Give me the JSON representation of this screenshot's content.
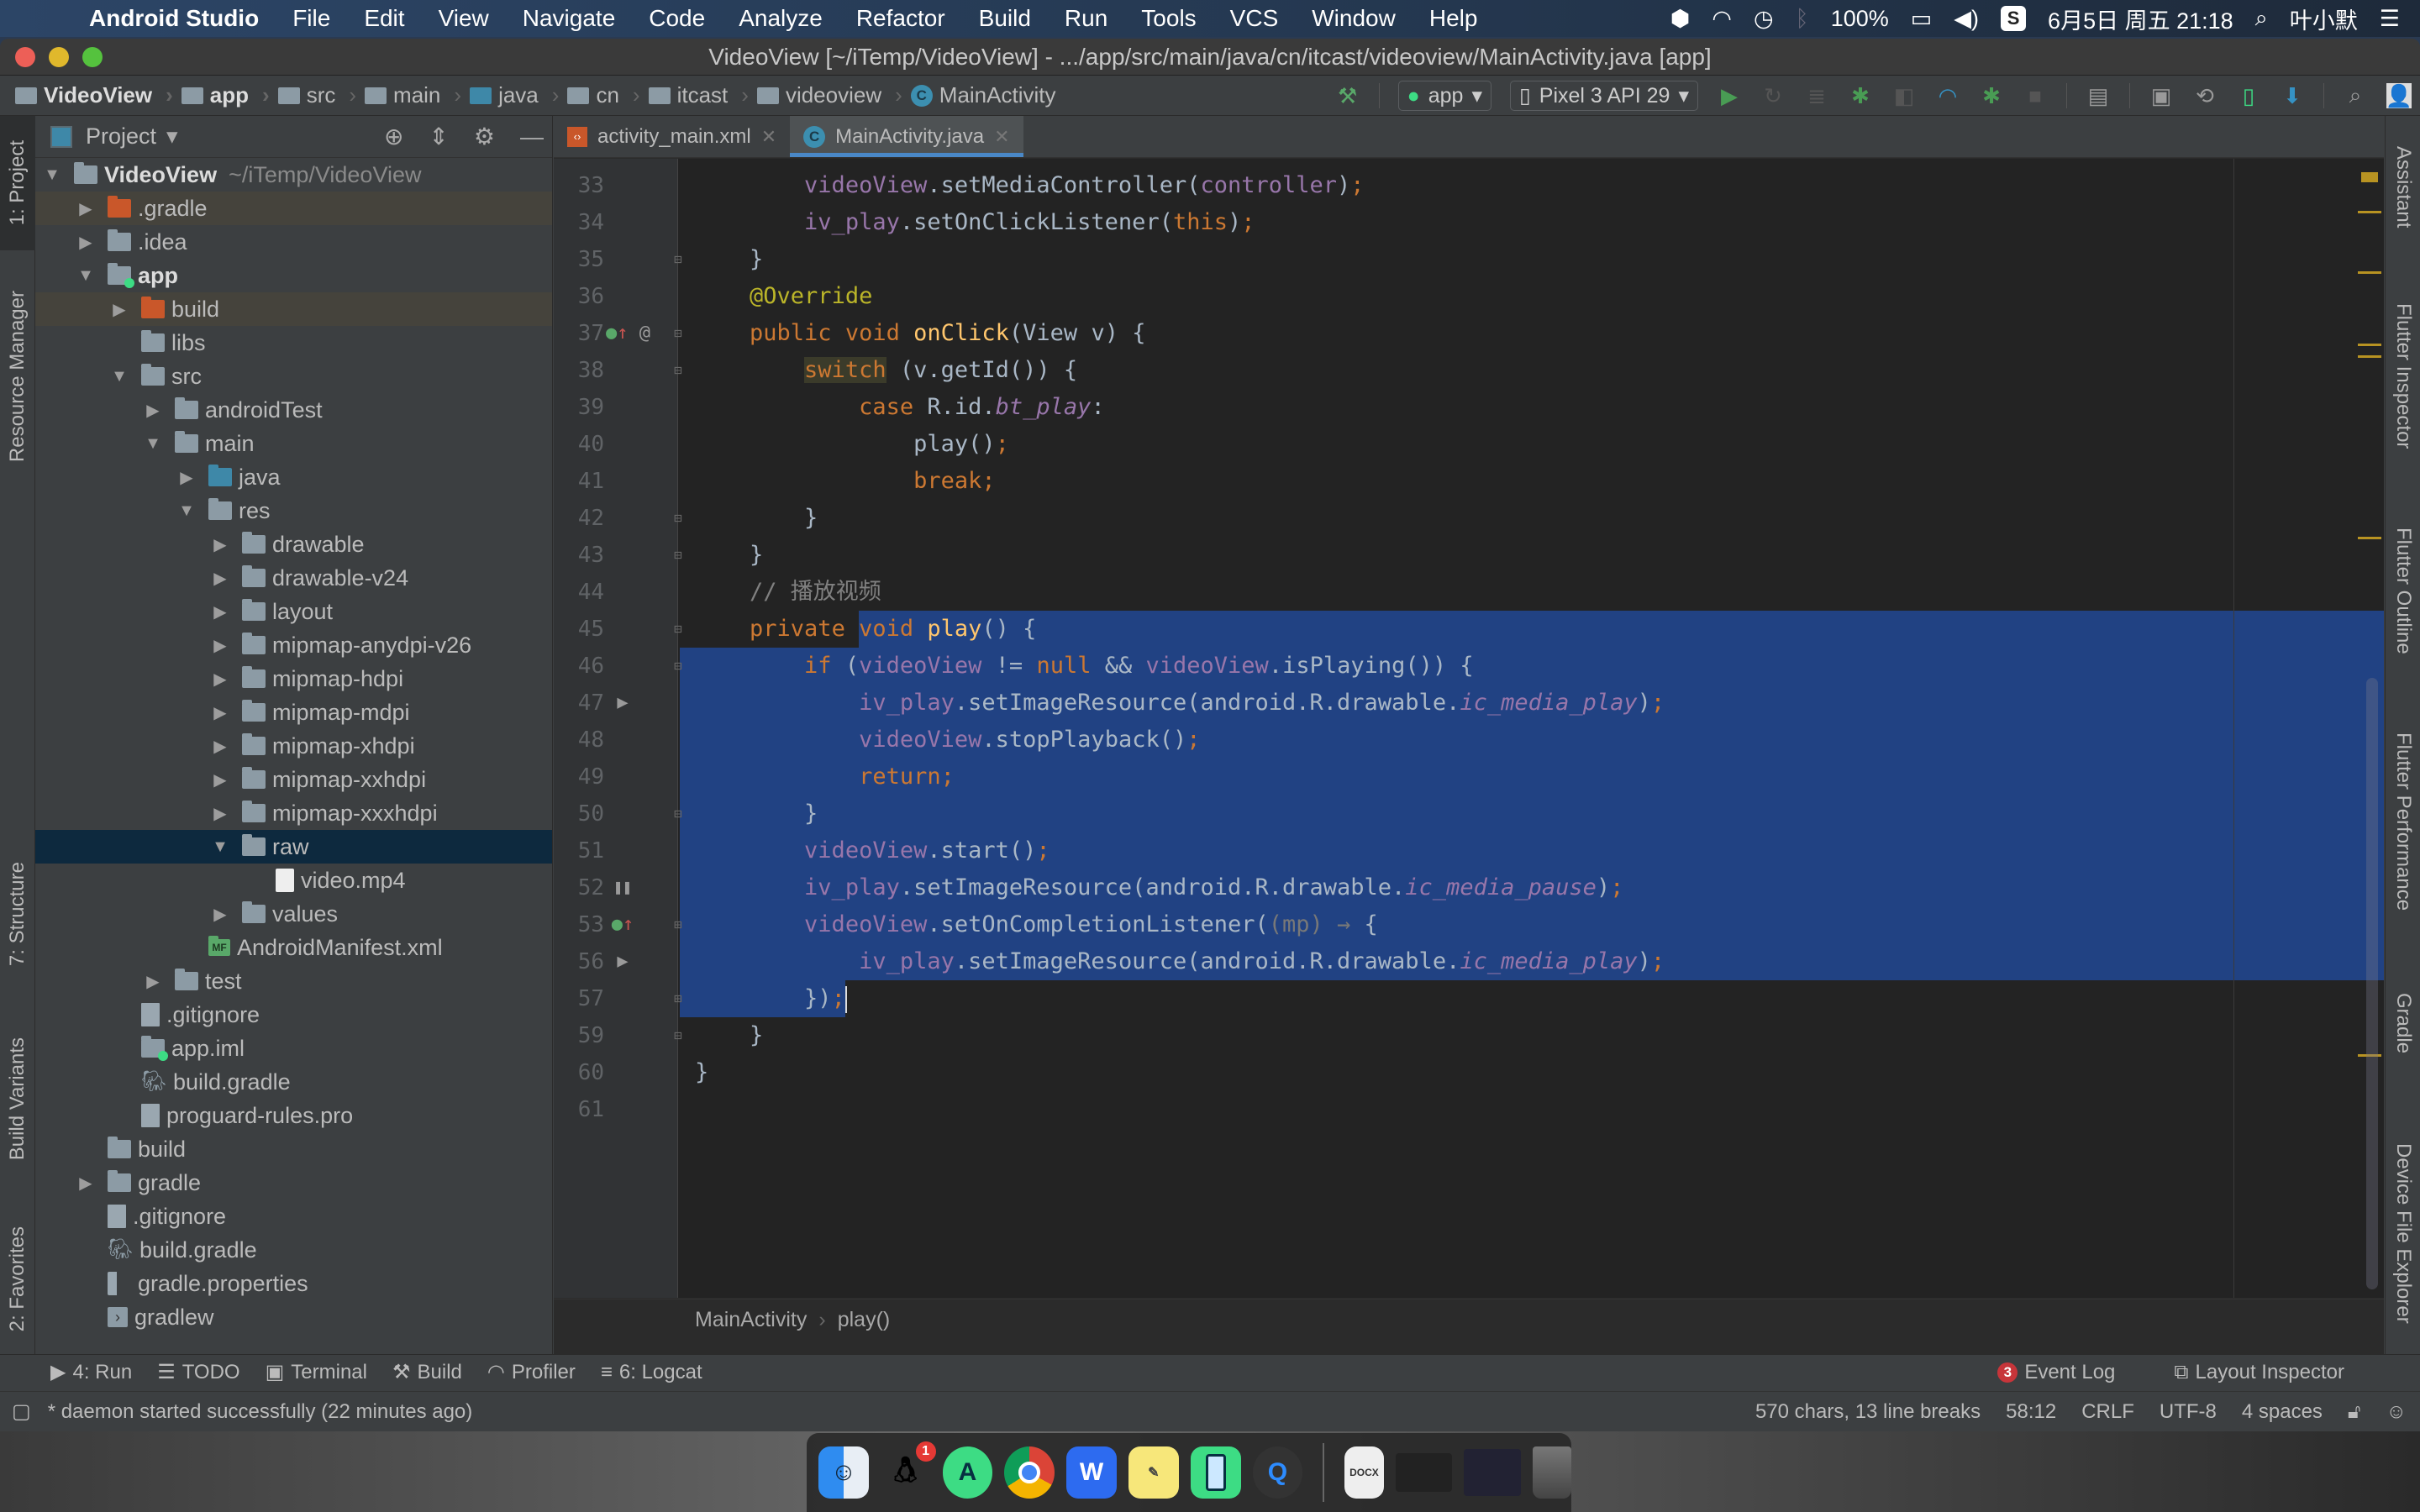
{
  "menubar": {
    "app_name": "Android Studio",
    "items": [
      "File",
      "Edit",
      "View",
      "Navigate",
      "Code",
      "Analyze",
      "Refactor",
      "Build",
      "Run",
      "Tools",
      "VCS",
      "Window",
      "Help"
    ],
    "battery": "100%",
    "datetime": "6月5日 周五 21:18",
    "user": "叶小默"
  },
  "window": {
    "title": "VideoView [~/iTemp/VideoView] - .../app/src/main/java/cn/itcast/videoview/MainActivity.java [app]"
  },
  "navbar": {
    "crumbs": [
      "VideoView",
      "app",
      "src",
      "main",
      "java",
      "cn",
      "itcast",
      "videoview",
      "MainActivity"
    ],
    "run_config": "app",
    "device": "Pixel 3 API 29"
  },
  "left_strip": {
    "tabs": [
      "1: Project",
      "Resource Manager",
      "7: Structure",
      "Build Variants",
      "2: Favorites"
    ]
  },
  "right_strip": {
    "tabs": [
      "Assistant",
      "Flutter Inspector",
      "Flutter Outline",
      "Flutter Performance",
      "Gradle",
      "Device File Explorer"
    ]
  },
  "project": {
    "view_label": "Project",
    "tree": [
      {
        "label": "VideoView",
        "path": "~/iTemp/VideoView",
        "depth": 0,
        "arrow": "open",
        "icon": "module",
        "bold": true
      },
      {
        "label": ".gradle",
        "depth": 1,
        "arrow": "closed",
        "icon": "folder-orange",
        "excluded": true
      },
      {
        "label": ".idea",
        "depth": 1,
        "arrow": "closed",
        "icon": "folder"
      },
      {
        "label": "app",
        "depth": 1,
        "arrow": "open",
        "icon": "module-app",
        "bold": true
      },
      {
        "label": "build",
        "depth": 2,
        "arrow": "closed",
        "icon": "folder-orange",
        "excluded": true
      },
      {
        "label": "libs",
        "depth": 2,
        "arrow": "none",
        "icon": "folder"
      },
      {
        "label": "src",
        "depth": 2,
        "arrow": "open",
        "icon": "folder"
      },
      {
        "label": "androidTest",
        "depth": 3,
        "arrow": "closed",
        "icon": "folder"
      },
      {
        "label": "main",
        "depth": 3,
        "arrow": "open",
        "icon": "folder"
      },
      {
        "label": "java",
        "depth": 4,
        "arrow": "closed",
        "icon": "folder-blue"
      },
      {
        "label": "res",
        "depth": 4,
        "arrow": "open",
        "icon": "folder-res"
      },
      {
        "label": "drawable",
        "depth": 5,
        "arrow": "closed",
        "icon": "folder"
      },
      {
        "label": "drawable-v24",
        "depth": 5,
        "arrow": "closed",
        "icon": "folder"
      },
      {
        "label": "layout",
        "depth": 5,
        "arrow": "closed",
        "icon": "folder"
      },
      {
        "label": "mipmap-anydpi-v26",
        "depth": 5,
        "arrow": "closed",
        "icon": "folder"
      },
      {
        "label": "mipmap-hdpi",
        "depth": 5,
        "arrow": "closed",
        "icon": "folder"
      },
      {
        "label": "mipmap-mdpi",
        "depth": 5,
        "arrow": "closed",
        "icon": "folder"
      },
      {
        "label": "mipmap-xhdpi",
        "depth": 5,
        "arrow": "closed",
        "icon": "folder"
      },
      {
        "label": "mipmap-xxhdpi",
        "depth": 5,
        "arrow": "closed",
        "icon": "folder"
      },
      {
        "label": "mipmap-xxxhdpi",
        "depth": 5,
        "arrow": "closed",
        "icon": "folder"
      },
      {
        "label": "raw",
        "depth": 5,
        "arrow": "open",
        "icon": "folder",
        "selected": true
      },
      {
        "label": "video.mp4",
        "depth": 6,
        "arrow": "none",
        "icon": "mp4"
      },
      {
        "label": "values",
        "depth": 5,
        "arrow": "closed",
        "icon": "folder"
      },
      {
        "label": "AndroidManifest.xml",
        "depth": 4,
        "arrow": "none",
        "icon": "manifest"
      },
      {
        "label": "test",
        "depth": 3,
        "arrow": "closed",
        "icon": "folder"
      },
      {
        "label": ".gitignore",
        "depth": 2,
        "arrow": "none",
        "icon": "file"
      },
      {
        "label": "app.iml",
        "depth": 2,
        "arrow": "none",
        "icon": "iml"
      },
      {
        "label": "build.gradle",
        "depth": 2,
        "arrow": "none",
        "icon": "gradle"
      },
      {
        "label": "proguard-rules.pro",
        "depth": 2,
        "arrow": "none",
        "icon": "file"
      },
      {
        "label": "build",
        "depth": 1,
        "arrow": "none",
        "icon": "folder"
      },
      {
        "label": "gradle",
        "depth": 1,
        "arrow": "closed",
        "icon": "folder"
      },
      {
        "label": ".gitignore",
        "depth": 1,
        "arrow": "none",
        "icon": "file"
      },
      {
        "label": "build.gradle",
        "depth": 1,
        "arrow": "none",
        "icon": "gradle"
      },
      {
        "label": "gradle.properties",
        "depth": 1,
        "arrow": "none",
        "icon": "props"
      },
      {
        "label": "gradlew",
        "depth": 1,
        "arrow": "none",
        "icon": "shell"
      }
    ]
  },
  "editor": {
    "tabs": [
      {
        "label": "activity_main.xml",
        "active": false
      },
      {
        "label": "MainActivity.java",
        "active": true
      }
    ],
    "lines": [
      {
        "n": "33",
        "html": "        <span class=\"v\">videoView</span>.setMediaController(<span class=\"v\">controller</span>)<span class=\"k\">;</span>"
      },
      {
        "n": "34",
        "html": "        <span class=\"v\">iv_play</span>.setOnClickListener(<span class=\"k\">this</span>)<span class=\"k\">;</span>"
      },
      {
        "n": "35",
        "html": "    }",
        "fold": "end"
      },
      {
        "n": "36",
        "html": "    <span class=\"ann\">@Override</span>"
      },
      {
        "n": "37",
        "html": "    <span class=\"k\">public void </span><span class=\"fn\">onClick</span>(View v) {",
        "gutter": "override",
        "fold": "start"
      },
      {
        "n": "38",
        "html": "        <span class=\"k sw\">switch</span> (v.getId()) {",
        "fold": "start"
      },
      {
        "n": "39",
        "html": "            <span class=\"k\">case </span>R.id.<span class=\"vi\">bt_play</span>:"
      },
      {
        "n": "40",
        "html": "                play()<span class=\"k\">;</span>"
      },
      {
        "n": "41",
        "html": "                <span class=\"k\">break;</span>"
      },
      {
        "n": "42",
        "html": "        }",
        "fold": "end"
      },
      {
        "n": "43",
        "html": "    }",
        "fold": "end"
      },
      {
        "n": "44",
        "html": "    <span class=\"cm\">// 播放视频</span>"
      },
      {
        "n": "45",
        "html": "    <span class=\"k\">private void </span><span class=\"fn\">play</span>() {",
        "fold": "start",
        "sel": "partial-start"
      },
      {
        "n": "46",
        "html": "        <span class=\"k\">if </span>(<span class=\"v\">videoView </span>!= <span class=\"k\">null </span>&amp;&amp; <span class=\"v\">videoView</span>.isPlaying()) {",
        "fold": "start",
        "sel": "full"
      },
      {
        "n": "47",
        "html": "            <span class=\"v\">iv_play</span>.setImageResource(android.R.drawable.<span class=\"vi\">ic_media_play</span>)<span class=\"k\">;</span>",
        "gutter": "play",
        "sel": "full"
      },
      {
        "n": "48",
        "html": "            <span class=\"v\">videoView</span>.stopPlayback()<span class=\"k\">;</span>",
        "sel": "full"
      },
      {
        "n": "49",
        "html": "            <span class=\"k\">return;</span>",
        "sel": "full"
      },
      {
        "n": "50",
        "html": "        }",
        "fold": "end",
        "sel": "full"
      },
      {
        "n": "51",
        "html": "        <span class=\"v\">videoView</span>.start()<span class=\"k\">;</span>",
        "sel": "full"
      },
      {
        "n": "52",
        "html": "        <span class=\"v\">iv_play</span>.setImageResource(android.R.drawable.<span class=\"vi\">ic_media_pause</span>)<span class=\"k\">;</span>",
        "gutter": "pause",
        "sel": "full"
      },
      {
        "n": "53",
        "html": "        <span class=\"v\">videoView</span>.setOnCompletionListener(<span class=\"dim\">(mp) → </span>{",
        "gutter": "override",
        "fold": "plus",
        "sel": "full"
      },
      {
        "n": "56",
        "html": "            <span class=\"v\">iv_play</span>.setImageResource(android.R.drawable.<span class=\"vi\">ic_media_play</span>)<span class=\"k\">;</span>",
        "gutter": "play",
        "sel": "full"
      },
      {
        "n": "57",
        "html": "        })<span class=\"k\">;</span><span class=\"caret\"></span>",
        "fold": "plus",
        "sel": "partial-end"
      },
      {
        "n": "59",
        "html": "    }",
        "fold": "end"
      },
      {
        "n": "60",
        "html": "}"
      },
      {
        "n": "61",
        "html": ""
      }
    ],
    "breadcrumb": [
      "MainActivity",
      "play()"
    ]
  },
  "bottom_tools": {
    "left": [
      "4: Run",
      "TODO",
      "Terminal",
      "Build",
      "Profiler",
      "6: Logcat"
    ],
    "event_log": "Event Log",
    "event_count": "3",
    "layout_inspector": "Layout Inspector"
  },
  "statusbar": {
    "message": "* daemon started successfully (22 minutes ago)",
    "selection": "570 chars, 13 line breaks",
    "position": "58:12",
    "line_sep": "CRLF",
    "encoding": "UTF-8",
    "indent": "4 spaces"
  },
  "dock": {
    "apps": [
      "Finder",
      "QQ",
      "Android Studio",
      "Chrome",
      "WPS",
      "Stickies",
      "Mobile",
      "QuickTime"
    ],
    "qq_badge": "1",
    "docs": [
      "DOCX",
      "Screenshot",
      "Screenshot",
      "Trash"
    ]
  }
}
